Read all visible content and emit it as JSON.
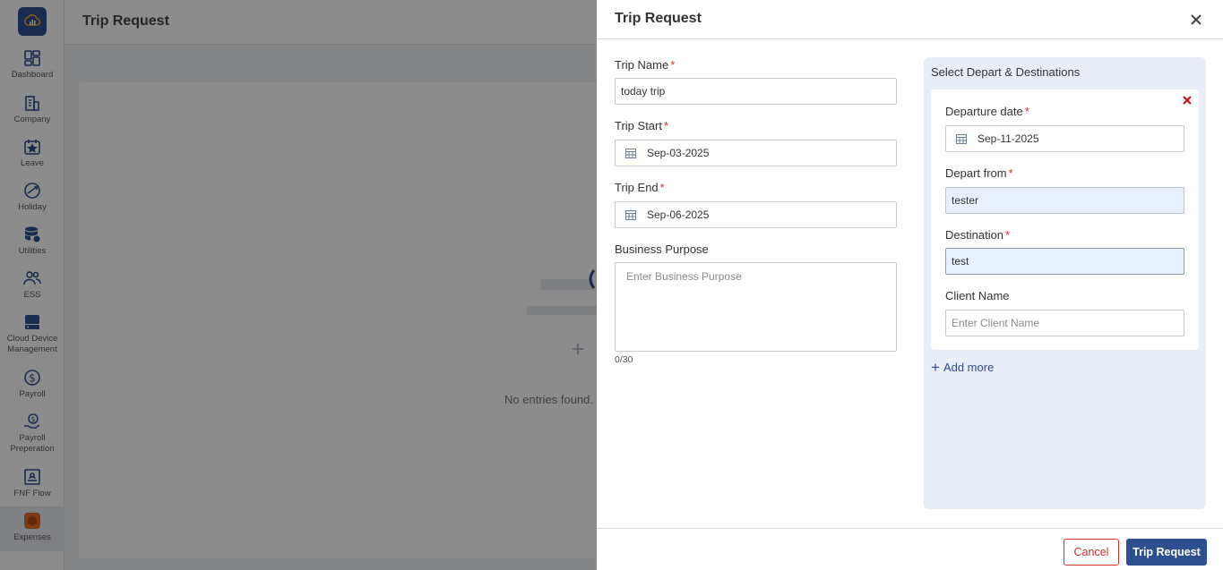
{
  "sidebar": {
    "items": [
      {
        "label": "Dashboard",
        "icon": "dashboard-icon"
      },
      {
        "label": "Company",
        "icon": "company-icon"
      },
      {
        "label": "Leave",
        "icon": "leave-icon"
      },
      {
        "label": "Holiday",
        "icon": "holiday-icon"
      },
      {
        "label": "Utilities",
        "icon": "utilities-icon"
      },
      {
        "label": "ESS",
        "icon": "ess-icon"
      },
      {
        "label": "Cloud Device Management",
        "icon": "cloud-device-icon"
      },
      {
        "label": "Payroll",
        "icon": "payroll-icon"
      },
      {
        "label": "Payroll Preperation",
        "icon": "payroll-preparation-icon"
      },
      {
        "label": "FNF Flow",
        "icon": "fnf-flow-icon"
      },
      {
        "label": "Expenses",
        "icon": "expenses-icon"
      }
    ],
    "active": "Expenses"
  },
  "page": {
    "title": "Trip Request",
    "empty_text": "No entries found."
  },
  "drawer": {
    "title": "Trip Request",
    "trip_name": {
      "label": "Trip Name",
      "value": "today trip"
    },
    "trip_start": {
      "label": "Trip Start",
      "value": "Sep-03-2025"
    },
    "trip_end": {
      "label": "Trip End",
      "value": "Sep-06-2025"
    },
    "business_purpose": {
      "label": "Business Purpose",
      "placeholder": "Enter Business Purpose",
      "counter": "0/30"
    },
    "destinations": {
      "title": "Select Depart & Destinations",
      "departure_date": {
        "label": "Departure date",
        "value": "Sep-11-2025"
      },
      "depart_from": {
        "label": "Depart from",
        "value": "tester"
      },
      "destination": {
        "label": "Destination",
        "value": "test"
      },
      "client_name": {
        "label": "Client Name",
        "placeholder": "Enter Client Name"
      },
      "add_more": "Add more"
    },
    "footer": {
      "cancel": "Cancel",
      "submit": "Trip Request"
    }
  },
  "colors": {
    "primary": "#2d4f8e",
    "danger": "#d32f2f",
    "panel": "#e9edf7"
  }
}
